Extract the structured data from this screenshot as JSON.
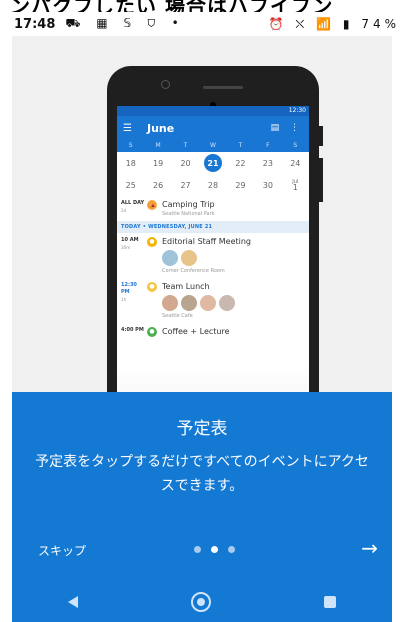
{
  "top_cut_text": "ンパクフしたい 場合はハフイフン",
  "status": {
    "time": "17:48",
    "left_icons": "⛟ ▦ 𝕊 ⛉ •",
    "right_icons": "⏰ ⛌ 📶 ▮ 74%"
  },
  "mock": {
    "status_time": "12:30",
    "month": "June",
    "weekdays": [
      "S",
      "M",
      "T",
      "W",
      "T",
      "F",
      "S"
    ],
    "week1": [
      "18",
      "19",
      "20",
      "21",
      "22",
      "23",
      "24"
    ],
    "week2": [
      "25",
      "26",
      "27",
      "28",
      "29",
      "30",
      "1"
    ],
    "week2_sup": "Jul",
    "allday": "ALL DAY",
    "allday_sub": "2d",
    "camping_title": "Camping Trip",
    "camping_loc": "Seattle National Park",
    "today_header": "TODAY • WEDNESDAY, JUNE 21",
    "ev1_time": "10 AM",
    "ev1_dur": "30m",
    "ev1_title": "Editorial Staff Meeting",
    "ev1_loc": "Corner Conference Room",
    "ev2_time": "12:30 PM",
    "ev2_dur": "1h",
    "ev2_title": "Team Lunch",
    "ev2_loc": "Seattle Cafe",
    "ev3_time": "4:00 PM",
    "ev3_title": "Coffee + Lecture"
  },
  "panel": {
    "title": "予定表",
    "description": "予定表をタップするだけですべてのイベントにアクセスできます。",
    "skip": "スキップ",
    "arrow": "→",
    "dots_active_index": 1
  },
  "colors": {
    "brand_blue": "#1479d3",
    "orange": "#f4a23c"
  }
}
